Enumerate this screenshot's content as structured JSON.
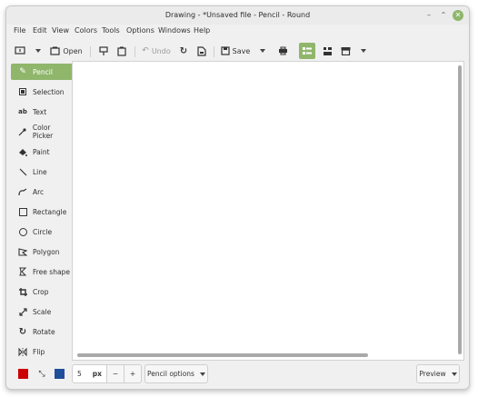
{
  "window": {
    "title": "Drawing - *Unsaved file - Pencil - Round",
    "controls": {
      "minimize": "–",
      "maximize": "⌃",
      "close": "✕"
    }
  },
  "menubar": [
    "File",
    "Edit",
    "View",
    "Colors",
    "Tools",
    "Options",
    "Windows",
    "Help"
  ],
  "toolbar": {
    "open_label": "Open",
    "undo_label": "Undo",
    "save_label": "Save"
  },
  "tools": [
    {
      "label": "Pencil",
      "icon": "pencil-icon",
      "active": true
    },
    {
      "label": "Selection",
      "icon": "selection-icon"
    },
    {
      "label": "Text",
      "icon": "text-icon"
    },
    {
      "label": "Color Picker",
      "icon": "color-picker-icon"
    },
    {
      "label": "Paint",
      "icon": "paint-bucket-icon"
    },
    {
      "label": "Line",
      "icon": "line-icon"
    },
    {
      "label": "Arc",
      "icon": "arc-icon"
    },
    {
      "label": "Rectangle",
      "icon": "rectangle-icon"
    },
    {
      "label": "Circle",
      "icon": "circle-icon"
    },
    {
      "label": "Polygon",
      "icon": "polygon-icon"
    },
    {
      "label": "Free shape",
      "icon": "free-shape-icon"
    },
    {
      "label": "Crop",
      "icon": "crop-icon"
    },
    {
      "label": "Scale",
      "icon": "scale-icon"
    },
    {
      "label": "Rotate",
      "icon": "rotate-icon"
    },
    {
      "label": "Flip",
      "icon": "flip-icon"
    }
  ],
  "bottombar": {
    "left_color": "#cc0000",
    "right_color": "#1f4f9a",
    "size_value": "5",
    "size_unit": "px",
    "minus_label": "−",
    "plus_label": "+",
    "tool_options_label": "Pencil options",
    "preview_label": "Preview"
  },
  "colors": {
    "accent": "#8fb66b"
  }
}
